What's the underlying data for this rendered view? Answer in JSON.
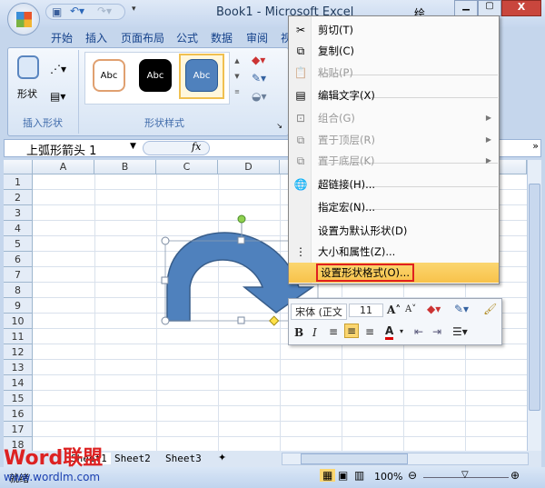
{
  "window": {
    "title": "Book1 - Microsoft Excel",
    "context_tab": "绘..."
  },
  "tabs": [
    "开始",
    "插入",
    "页面布局",
    "公式",
    "数据",
    "审阅",
    "视"
  ],
  "ribbon": {
    "insert_shapes": {
      "label": "插入形状",
      "shapes_button": "形状"
    },
    "shape_styles": {
      "label": "形状样式",
      "styles": [
        "Abc",
        "Abc",
        "Abc"
      ]
    }
  },
  "formula_bar": {
    "name_box": "上弧形箭头 1",
    "fx": "fx",
    "value": ""
  },
  "columns": [
    "A",
    "B",
    "C",
    "D"
  ],
  "rows": [
    "1",
    "2",
    "3",
    "4",
    "5",
    "6",
    "7",
    "8",
    "9",
    "10",
    "11",
    "12",
    "13",
    "14",
    "15",
    "16",
    "17",
    "18"
  ],
  "context_menu": {
    "items": [
      {
        "label": "剪切(T)",
        "icon": "scissors-icon",
        "enabled": true
      },
      {
        "label": "复制(C)",
        "icon": "copy-icon",
        "enabled": true
      },
      {
        "label": "粘贴(P)",
        "icon": "paste-icon",
        "enabled": false
      },
      {
        "label": "编辑文字(X)",
        "icon": "edit-text-icon",
        "enabled": true
      },
      {
        "label": "组合(G)",
        "icon": "group-icon",
        "enabled": false,
        "submenu": true
      },
      {
        "label": "置于顶层(R)",
        "icon": "bring-front-icon",
        "enabled": false,
        "submenu": true
      },
      {
        "label": "置于底层(K)",
        "icon": "send-back-icon",
        "enabled": false,
        "submenu": true
      },
      {
        "label": "超链接(H)...",
        "icon": "hyperlink-icon",
        "enabled": true
      },
      {
        "label": "指定宏(N)...",
        "icon": "",
        "enabled": true
      },
      {
        "label": "设置为默认形状(D)",
        "icon": "",
        "enabled": true
      },
      {
        "label": "大小和属性(Z)...",
        "icon": "size-icon",
        "enabled": true
      },
      {
        "label": "设置形状格式(O)...",
        "icon": "format-shape-icon",
        "enabled": true,
        "highlighted": true
      }
    ]
  },
  "mini_toolbar": {
    "font": "宋体 (正文",
    "size": "11",
    "bold": "B",
    "italic": "I",
    "font_color_letter": "A"
  },
  "sheet_tabs": [
    "Sheet1",
    "Sheet2",
    "Sheet3"
  ],
  "status": {
    "ready": "就绪",
    "zoom": "100%"
  },
  "watermark": {
    "logo": "Word联盟",
    "url": "www.wordlm.com"
  },
  "colors": {
    "shape_fill": "#4f81bd",
    "highlight_box": "#e02020",
    "menu_highlight": "#fbd670"
  }
}
